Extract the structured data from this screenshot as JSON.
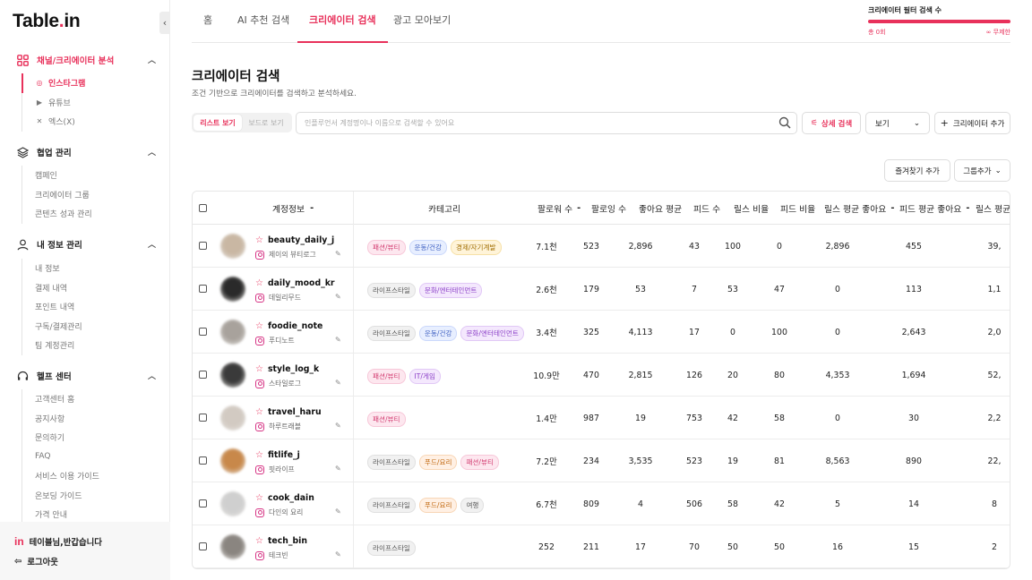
{
  "sidebar": {
    "logo_main": "Table",
    "logo_dot": ".",
    "logo_end": "in",
    "sections": [
      {
        "label": "채널/크리에이터 분석",
        "items": [
          {
            "label": "인스타그램",
            "icon": "instagram-icon"
          },
          {
            "label": "유튜브",
            "icon": "youtube-icon"
          },
          {
            "label": "엑스(X)",
            "icon": "x-icon"
          }
        ]
      },
      {
        "label": "협업 관리",
        "items": [
          {
            "label": "캠페인"
          },
          {
            "label": "크리에이터 그룹"
          },
          {
            "label": "콘텐츠 성과 관리"
          }
        ]
      },
      {
        "label": "내 정보 관리",
        "items": [
          {
            "label": "내 정보"
          },
          {
            "label": "결제 내역"
          },
          {
            "label": "포인트 내역"
          },
          {
            "label": "구독/결제관리"
          },
          {
            "label": "팀 계정관리"
          }
        ]
      },
      {
        "label": "헬프 센터",
        "items": [
          {
            "label": "고객센터 홈"
          },
          {
            "label": "공지사항"
          },
          {
            "label": "문의하기"
          },
          {
            "label": "FAQ"
          },
          {
            "label": "서비스 이용 가이드"
          },
          {
            "label": "온보딩 가이드"
          },
          {
            "label": "가격 안내"
          }
        ]
      }
    ],
    "welcome": "테이블님,반갑습니다",
    "welcome_logo": "in",
    "logout": "로그아웃"
  },
  "tabs": [
    {
      "label": "홈"
    },
    {
      "label": "AI 추천 검색"
    },
    {
      "label": "크리에이터 검색",
      "active": true
    },
    {
      "label": "광고 모아보기"
    }
  ],
  "quota": {
    "title": "크리에이터 필터 검색 수",
    "left": "총 0회",
    "right": "∞ 무제한"
  },
  "main": {
    "title": "크리에이터 검색",
    "subtitle": "조건 기반으로 크리에이터를 검색하고 분석하세요.",
    "view_list": "리스트 보기",
    "view_board": "보드로 보기",
    "search_placeholder": "인플루언서 계정명이나 이름으로 검색할 수 있어요",
    "detail_search": "상세 검색",
    "view_select": "보기",
    "add_creator": "크리에이터 추가",
    "add_favorite": "즐겨찾기 추가",
    "add_group": "그룹추가"
  },
  "table": {
    "headers": [
      "계정정보",
      "카테고리",
      "팔로워 수",
      "팔로잉 수",
      "좋아요 평균",
      "피드 수",
      "릴스 비율",
      "피드 비율",
      "릴스 평균 좋아요",
      "피드 평균 좋아요",
      "릴스 평균"
    ],
    "rows": [
      {
        "handle": "beauty_daily_j",
        "name": "제이의 뷰티로그",
        "avatar": "#c9b7a3",
        "tags": [
          {
            "t": "패션/뷰티",
            "c": "t-pink"
          },
          {
            "t": "운동/건강",
            "c": "t-blue"
          },
          {
            "t": "경제/자기계발",
            "c": "t-yel"
          }
        ],
        "followers": "7.1천",
        "following": "523",
        "likes": "2,896",
        "feeds": "43",
        "reels": "100",
        "feed_ratio": "0",
        "reels_likes": "2,896",
        "feed_likes": "455",
        "last": "39,"
      },
      {
        "handle": "daily_mood_kr",
        "name": "데일리무드",
        "avatar": "#2a2a2a",
        "tags": [
          {
            "t": "라이프스타일",
            "c": "t-gray"
          },
          {
            "t": "문화/엔터테인먼트",
            "c": "t-purple"
          }
        ],
        "followers": "2.6천",
        "following": "179",
        "likes": "53",
        "feeds": "7",
        "reels": "53",
        "feed_ratio": "47",
        "reels_likes": "0",
        "feed_likes": "113",
        "last": "1,1"
      },
      {
        "handle": "foodie_note",
        "name": "푸디노트",
        "avatar": "#a8a29c",
        "tags": [
          {
            "t": "라이프스타일",
            "c": "t-gray"
          },
          {
            "t": "운동/건강",
            "c": "t-blue"
          },
          {
            "t": "문화/엔터테인먼트",
            "c": "t-purple"
          }
        ],
        "followers": "3.4천",
        "following": "325",
        "likes": "4,113",
        "feeds": "17",
        "reels": "0",
        "feed_ratio": "100",
        "reels_likes": "0",
        "feed_likes": "2,643",
        "last": "2,0"
      },
      {
        "handle": "style_log_k",
        "name": "스타일로그",
        "avatar": "#3a3a3a",
        "tags": [
          {
            "t": "패션/뷰티",
            "c": "t-pink"
          },
          {
            "t": "IT/게임",
            "c": "t-purple"
          }
        ],
        "followers": "10.9만",
        "following": "470",
        "likes": "2,815",
        "feeds": "126",
        "reels": "20",
        "feed_ratio": "80",
        "reels_likes": "4,353",
        "feed_likes": "1,694",
        "last": "52,"
      },
      {
        "handle": "travel_haru",
        "name": "하루트래블",
        "avatar": "#d2cac2",
        "tags": [
          {
            "t": "패션/뷰티",
            "c": "t-pink"
          }
        ],
        "followers": "1.4만",
        "following": "987",
        "likes": "19",
        "feeds": "753",
        "reels": "42",
        "feed_ratio": "58",
        "reels_likes": "0",
        "feed_likes": "30",
        "last": "2,2"
      },
      {
        "handle": "fitlife_j",
        "name": "핏라이프",
        "avatar": "#c8884a",
        "tags": [
          {
            "t": "라이프스타일",
            "c": "t-gray"
          },
          {
            "t": "푸드/요리",
            "c": "t-orange"
          },
          {
            "t": "패션/뷰티",
            "c": "t-pink"
          }
        ],
        "followers": "7.2만",
        "following": "234",
        "likes": "3,535",
        "feeds": "523",
        "reels": "19",
        "feed_ratio": "81",
        "reels_likes": "8,563",
        "feed_likes": "890",
        "last": "22,"
      },
      {
        "handle": "cook_dain",
        "name": "다인의 요리",
        "avatar": "#cfcfcf",
        "tags": [
          {
            "t": "라이프스타일",
            "c": "t-gray"
          },
          {
            "t": "푸드/요리",
            "c": "t-orange"
          },
          {
            "t": "여행",
            "c": "t-gray"
          }
        ],
        "followers": "6.7천",
        "following": "809",
        "likes": "4",
        "feeds": "506",
        "reels": "58",
        "feed_ratio": "42",
        "reels_likes": "5",
        "feed_likes": "14",
        "last": "8"
      },
      {
        "handle": "tech_bin",
        "name": "테크빈",
        "avatar": "#8a8580",
        "tags": [
          {
            "t": "라이프스타일",
            "c": "t-gray"
          }
        ],
        "followers": "252",
        "following": "211",
        "likes": "17",
        "feeds": "70",
        "reels": "50",
        "feed_ratio": "50",
        "reels_likes": "16",
        "feed_likes": "15",
        "last": "2"
      }
    ]
  },
  "colors": {
    "accent": "#e8315b"
  }
}
